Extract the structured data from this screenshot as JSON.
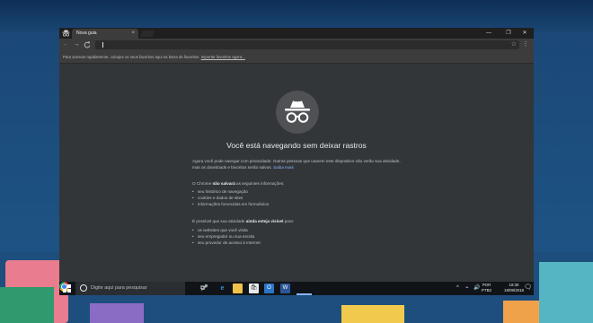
{
  "window": {
    "tab_title": "Nova guia",
    "tab_close": "×",
    "controls": {
      "minimize": "—",
      "maximize": "❐",
      "close": "✕"
    }
  },
  "toolbar": {
    "back": "←",
    "forward": "→",
    "reload": "C",
    "address_value": "",
    "star": "☆",
    "menu": "⋮"
  },
  "bookmarks_bar": {
    "text": "Para acessar rapidamente, coloque os seus favoritos aqui na barra de favoritos.",
    "link": "Importar favoritos agora..."
  },
  "incognito": {
    "heading": "Você está navegando sem deixar rastros",
    "p1_text": "Agora você pode navegar com privacidade. Outras pessoas que usarem este dispositivo não verão sua atividade, mas os downloads e favoritos serão salvos.",
    "p1_link": "Saiba mais",
    "p2_before": "O Chrome ",
    "p2_bold": "não salvará",
    "p2_after": " as seguintes informações:",
    "list1": [
      "seu histórico de navegação",
      "cookies e dados de sites",
      "informações fornecidas em formulários"
    ],
    "p3_before": "É possível que sua atividade ",
    "p3_bold": "ainda esteja visível",
    "p3_after": " para:",
    "list2": [
      "os websites que você visita",
      "seu empregador ou sua escola",
      "seu provedor de acesso à Internet"
    ]
  },
  "taskbar": {
    "search_placeholder": "Digite aqui para pesquisar",
    "mic": "🎤",
    "task_view": "⧉",
    "edge": "e",
    "store": "🛍",
    "outlook": "O",
    "word": "W",
    "tray_up": "^",
    "tray_net": "⌁",
    "tray_vol": "🔊",
    "lang_top": "POR",
    "lang_bottom": "PTB2",
    "time": "18:30",
    "date": "19/09/2018",
    "notifications": "🗨"
  },
  "colors": {
    "content_bg": "#323639",
    "link": "#8ab4f8",
    "taskbar_bg": "#101418"
  }
}
